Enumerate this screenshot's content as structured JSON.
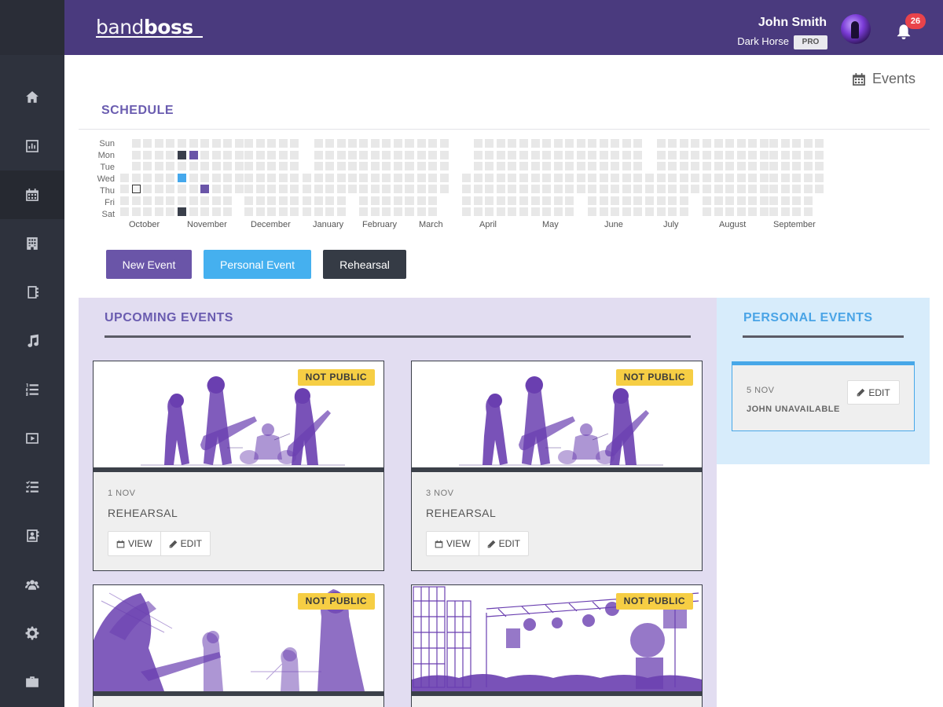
{
  "brand": {
    "light": "band",
    "bold": "boss"
  },
  "user": {
    "name": "John Smith",
    "band": "Dark Horse",
    "plan_badge": "PRO"
  },
  "notifications": {
    "count": "26"
  },
  "page": {
    "label": "Events"
  },
  "sidebar": {
    "items": [
      {
        "name": "home",
        "icon": "home-icon",
        "active": false
      },
      {
        "name": "dashboard",
        "icon": "bar-chart-icon",
        "active": false
      },
      {
        "name": "events",
        "icon": "calendar-icon",
        "active": true
      },
      {
        "name": "venues",
        "icon": "building-icon",
        "active": false
      },
      {
        "name": "notebook",
        "icon": "notebook-icon",
        "active": false
      },
      {
        "name": "music",
        "icon": "music-note-icon",
        "active": false
      },
      {
        "name": "setlists",
        "icon": "numbered-list-icon",
        "active": false
      },
      {
        "name": "media",
        "icon": "video-icon",
        "active": false
      },
      {
        "name": "tasks",
        "icon": "checklist-icon",
        "active": false
      },
      {
        "name": "contacts",
        "icon": "contact-book-icon",
        "active": false
      },
      {
        "name": "members",
        "icon": "users-icon",
        "active": false
      },
      {
        "name": "settings",
        "icon": "gear-icon",
        "active": false
      },
      {
        "name": "business",
        "icon": "briefcase-icon",
        "active": false
      }
    ]
  },
  "schedule": {
    "title": "SCHEDULE",
    "days": [
      "Sun",
      "Mon",
      "Tue",
      "Wed",
      "Thu",
      "Fri",
      "Sat"
    ],
    "months": [
      "October",
      "November",
      "December",
      "January",
      "February",
      "March",
      "April",
      "May",
      "June",
      "July",
      "August",
      "September"
    ],
    "colors": {
      "empty": "#e8e8e8",
      "rehearsal": "#3a3f4b",
      "new_event": "#6a55a8",
      "personal": "#45a8ec",
      "today_outline": "#333333"
    },
    "highlighted": [
      {
        "month": "November",
        "day": "Mon",
        "type": "rehearsal"
      },
      {
        "month": "November",
        "day": "Mon",
        "type": "new_event"
      },
      {
        "month": "November",
        "day": "Wed",
        "type": "personal"
      },
      {
        "month": "November",
        "day": "Thu",
        "type": "new_event"
      },
      {
        "month": "October",
        "day": "Sat",
        "type": "rehearsal"
      },
      {
        "month": "October",
        "day": "Thu",
        "type": "today"
      }
    ]
  },
  "actions": {
    "new_event": {
      "label": "New Event",
      "color": "#6a55a8"
    },
    "personal_event": {
      "label": "Personal Event",
      "color": "#45b0ef"
    },
    "rehearsal": {
      "label": "Rehearsal",
      "color": "#353b45"
    }
  },
  "upcoming": {
    "title": "UPCOMING EVENTS",
    "events": [
      {
        "badge": "NOT PUBLIC",
        "date": "1 NOV",
        "title": "REHEARSAL",
        "view_label": "VIEW",
        "edit_label": "EDIT",
        "image": "band-illustration"
      },
      {
        "badge": "NOT PUBLIC",
        "date": "3 NOV",
        "title": "REHEARSAL",
        "view_label": "VIEW",
        "edit_label": "EDIT",
        "image": "band-illustration"
      },
      {
        "badge": "NOT PUBLIC",
        "image": "guitarist-illustration"
      },
      {
        "badge": "NOT PUBLIC",
        "image": "stage-illustration"
      }
    ]
  },
  "personal": {
    "title": "PERSONAL EVENTS",
    "events": [
      {
        "date": "5 NOV",
        "title": "JOHN UNAVAILABLE",
        "edit_label": "EDIT"
      }
    ]
  }
}
